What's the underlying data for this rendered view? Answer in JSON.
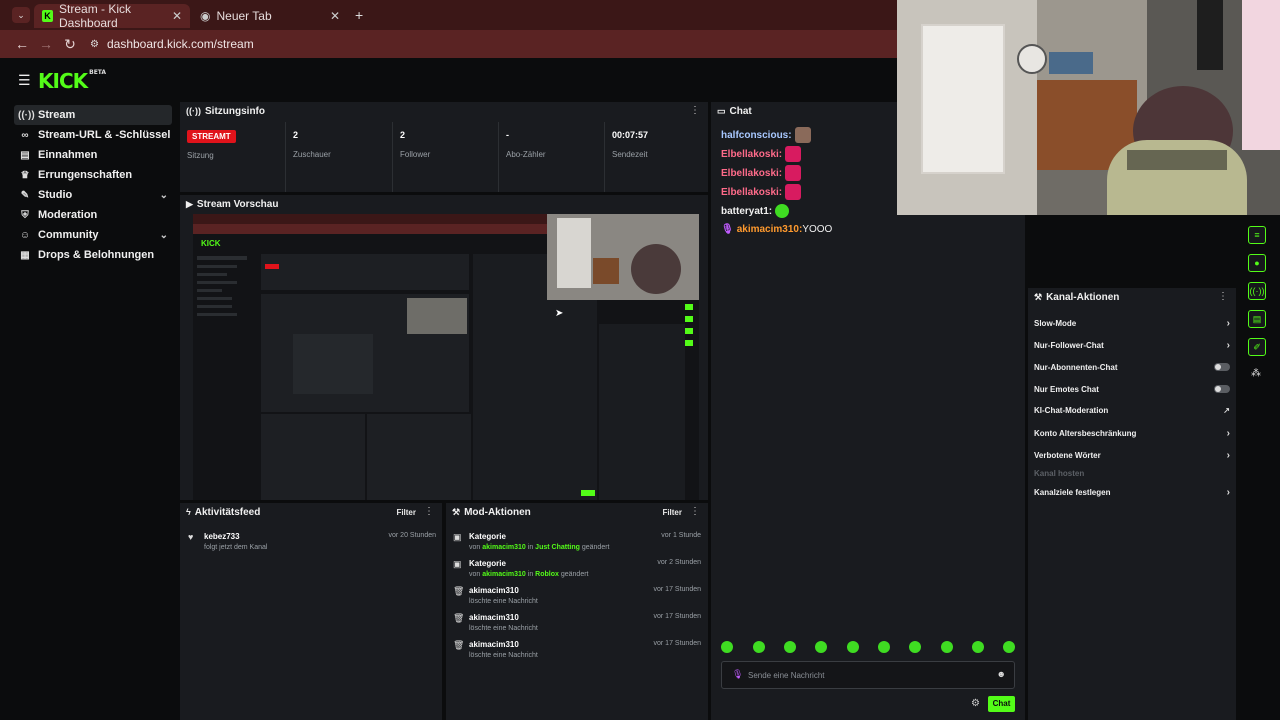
{
  "browser": {
    "tabs": [
      {
        "label": "Stream - Kick Dashboard",
        "active": true
      },
      {
        "label": "Neuer Tab",
        "active": false
      }
    ],
    "url": "dashboard.kick.com/stream"
  },
  "header": {
    "logo": "KICK",
    "logo_badge": "BETA"
  },
  "sidebar": {
    "items": [
      {
        "label": "Stream",
        "icon": "broadcast-icon",
        "active": true
      },
      {
        "label": "Stream-URL & -Schlüssel",
        "icon": "link-icon"
      },
      {
        "label": "Einnahmen",
        "icon": "wallet-icon"
      },
      {
        "label": "Errungenschaften",
        "icon": "trophy-icon"
      },
      {
        "label": "Studio",
        "icon": "studio-icon",
        "expandable": true
      },
      {
        "label": "Moderation",
        "icon": "shield-icon"
      },
      {
        "label": "Community",
        "icon": "community-icon",
        "expandable": true
      },
      {
        "label": "Drops & Belohnungen",
        "icon": "gift-icon"
      }
    ]
  },
  "session": {
    "title": "Sitzungsinfo",
    "live_badge": "STREAMT",
    "live_label": "Sitzung",
    "viewers_value": "2",
    "viewers_label": "Zuschauer",
    "followers_value": "2",
    "followers_label": "Follower",
    "subs_value": "-",
    "subs_label": "Abo-Zähler",
    "time_value": "00:07:57",
    "time_label": "Sendezeit"
  },
  "preview": {
    "title": "Stream Vorschau"
  },
  "activity": {
    "title": "Aktivitätsfeed",
    "filter": "Filter",
    "items": [
      {
        "user": "kebez733",
        "text": "folgt jetzt dem Kanal",
        "time": "vor 20 Stunden"
      }
    ]
  },
  "mod": {
    "title": "Mod-Aktionen",
    "filter": "Filter",
    "items": [
      {
        "title": "Kategorie",
        "pre": "von ",
        "user": "akimacim310",
        "mid": " in ",
        "target": "Just Chatting",
        "post": " geändert",
        "time": "vor 1 Stunde"
      },
      {
        "title": "Kategorie",
        "pre": "von ",
        "user": "akimacim310",
        "mid": " in ",
        "target": "Roblox",
        "post": " geändert",
        "time": "vor 2 Stunden"
      },
      {
        "title": "akimacim310",
        "text": "löschte eine Nachricht",
        "time": "vor 17 Stunden"
      },
      {
        "title": "akimacim310",
        "text": "löschte eine Nachricht",
        "time": "vor 17 Stunden"
      },
      {
        "title": "akimacim310",
        "text": "löschte eine Nachricht",
        "time": "vor 17 Stunden"
      }
    ]
  },
  "chat": {
    "title": "Chat",
    "messages": [
      {
        "user": "halfconscious:",
        "color": "#a8c8ff",
        "text": ""
      },
      {
        "user": "Elbellakoski:",
        "color": "#ff6b8a",
        "text": ""
      },
      {
        "user": "Elbellakoski:",
        "color": "#ff6b8a",
        "text": ""
      },
      {
        "user": "Elbellakoski:",
        "color": "#ff6b8a",
        "text": ""
      },
      {
        "user": "batteryat1:",
        "color": "#f0f0f0",
        "text": ""
      },
      {
        "user": "akimacim310:",
        "color": "#ff9a2e",
        "text": " YOOO"
      }
    ],
    "input_placeholder": "Sende eine Nachricht",
    "send_label": "Chat"
  },
  "kanal": {
    "title": "Kanal-Aktionen",
    "items": [
      {
        "label": "Slow-Mode",
        "control": "chevron"
      },
      {
        "label": "Nur-Follower-Chat",
        "control": "chevron"
      },
      {
        "label": "Nur-Abonnenten-Chat",
        "control": "toggle"
      },
      {
        "label": "Nur Emotes Chat",
        "control": "toggle"
      },
      {
        "label": "KI-Chat-Moderation",
        "control": "external"
      },
      {
        "label": "Konto Altersbeschränkung",
        "control": "chevron"
      },
      {
        "label": "Verbotene Wörter",
        "control": "chevron"
      },
      {
        "label": "Kanal hosten",
        "control": "none",
        "disabled": true
      },
      {
        "label": "Kanalziele festlegen",
        "control": "chevron"
      }
    ]
  }
}
